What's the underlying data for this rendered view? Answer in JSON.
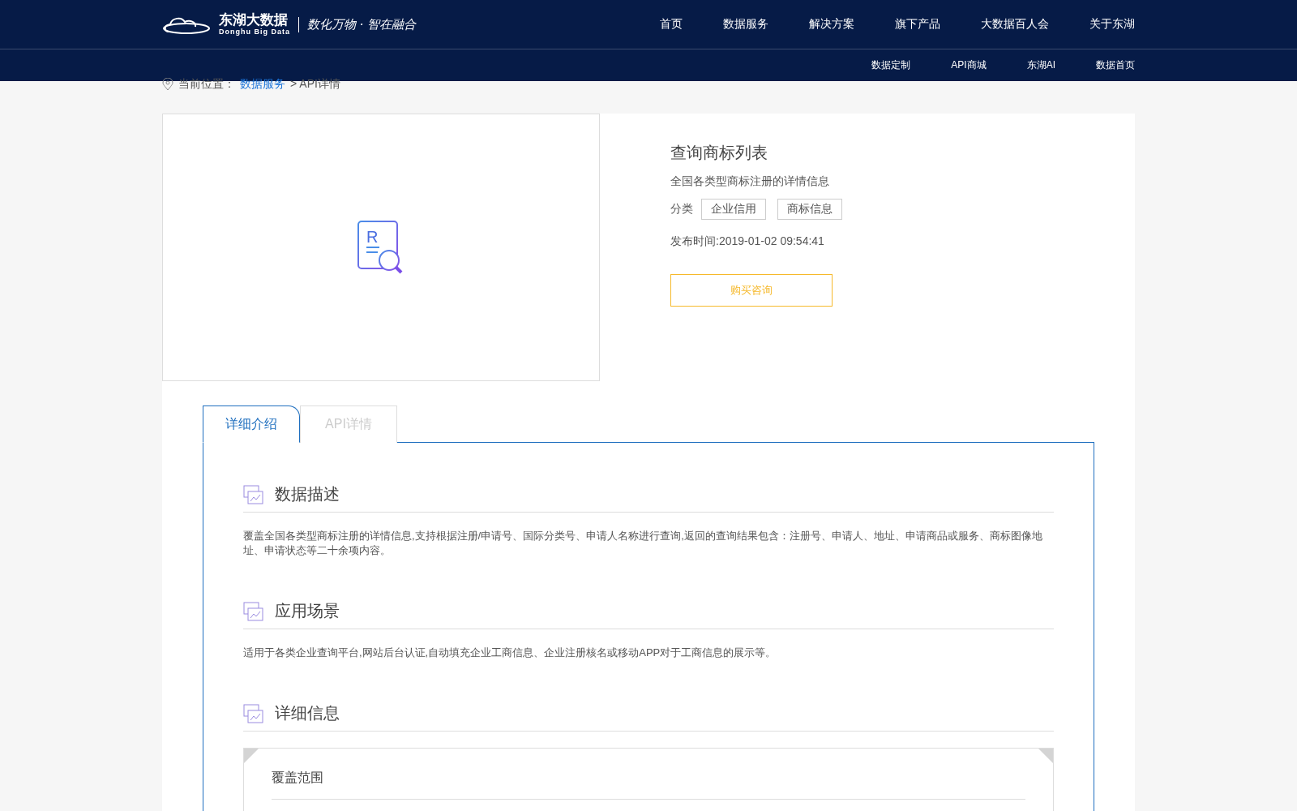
{
  "header": {
    "logo": {
      "name": "东湖大数据",
      "subtitle": "Donghu Big Data",
      "slogan": "数化万物 · 智在融合"
    },
    "nav": [
      {
        "label": "首页",
        "selected": false
      },
      {
        "label": "数据服务",
        "selected": false
      },
      {
        "label": "解决方案",
        "selected": false
      },
      {
        "label": "旗下产品",
        "selected": false
      },
      {
        "label": "大数据百人会",
        "selected": false
      },
      {
        "label": "关于东湖",
        "selected": false
      }
    ],
    "subnav": [
      "数据定制",
      "API商城",
      "东湖AI",
      "数据首页"
    ]
  },
  "breadcrumb": {
    "label": "当前位置：",
    "link": "数据服务",
    "current": "> API详情"
  },
  "product": {
    "icon_letter": "R",
    "title": "查询商标列表",
    "description": "全国各类型商标注册的详情信息",
    "category_label": "分类",
    "tags": [
      "企业信用",
      "商标信息"
    ],
    "published": "发布时间:2019-01-02 09:54:41",
    "button": "购买咨询"
  },
  "tabs": [
    {
      "label": "详细介绍",
      "selected": true
    },
    {
      "label": "API详情",
      "selected": false
    }
  ],
  "sections": [
    {
      "title": "数据描述",
      "text": "覆盖全国各类型商标注册的详情信息,支持根据注册/申请号、国际分类号、申请人名称进行查询,返回的查询结果包含：注册号、申请人、地址、申请商品或服务、商标图像地址、申请状态等二十余项内容。"
    },
    {
      "title": "应用场景",
      "text": "适用于各类企业查询平台,网站后台认证,自动填充企业工商信息、企业注册核名或移动APP对于工商信息的展示等。"
    },
    {
      "title": "详细信息",
      "card": {
        "title": "覆盖范围"
      }
    }
  ]
}
